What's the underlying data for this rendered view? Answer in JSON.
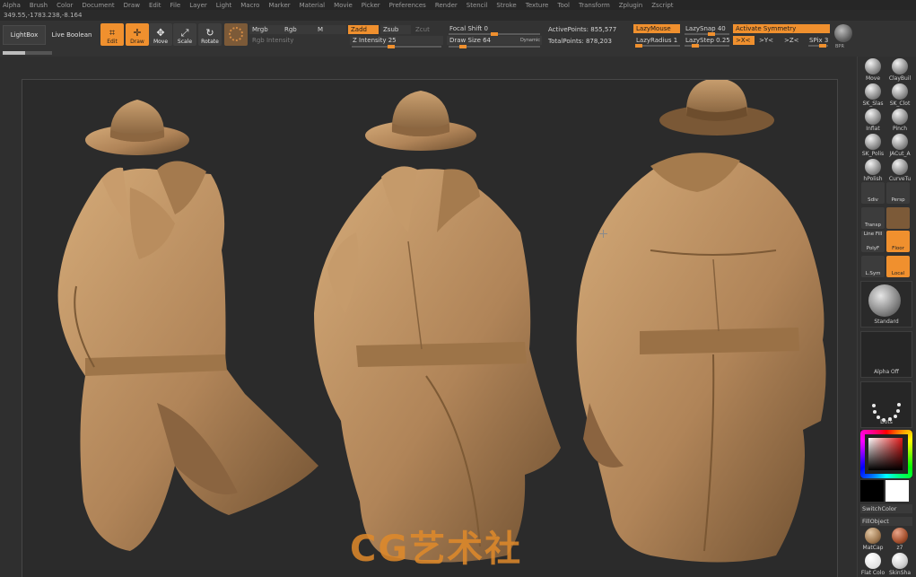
{
  "menu": [
    "Alpha",
    "Brush",
    "Color",
    "Document",
    "Draw",
    "Edit",
    "File",
    "Layer",
    "Light",
    "Macro",
    "Marker",
    "Material",
    "Movie",
    "Picker",
    "Preferences",
    "Render",
    "Stencil",
    "Stroke",
    "Texture",
    "Tool",
    "Transform",
    "Zplugin",
    "Zscript"
  ],
  "coord_readout": "349.55,-1783.238,-8.164",
  "toolbar": {
    "lightbox": "LightBox",
    "live_boolean": "Live Boolean",
    "edit": "Edit",
    "draw": "Draw",
    "move": "Move",
    "scale": "Scale",
    "rotate": "Rotate",
    "mrgb": "Mrgb",
    "rgb": "Rgb",
    "m": "M",
    "rgb_intensity": "Rgb Intensity",
    "zadd": "Zadd",
    "zsub": "Zsub",
    "zcut": "Zcut",
    "z_intensity": "Z Intensity 25",
    "focal_shift": "Focal Shift 0",
    "draw_size": "Draw Size 64",
    "dynamic": "Dynamic",
    "active_points": "ActivePoints: 855,577",
    "total_points": "TotalPoints: 878,203",
    "lazy_mouse": "LazyMouse",
    "lazy_snap": "LazySnap 40",
    "lazy_radius": "LazyRadius 1",
    "lazy_step": "LazyStep 0.25",
    "activate_symmetry": "Activate Symmetry",
    "sym_x": ">X<",
    "sym_y": ">Y<",
    "sym_z": ">Z<",
    "spix": "SPix 3",
    "brush_icon_label": "BPR",
    "progress": 0.45
  },
  "watermark": "CG艺术社",
  "tray": {
    "brushes": [
      "Move",
      "ClayBuil",
      "SK_Slas",
      "SK_Clot",
      "Inflat",
      "Pinch",
      "SK_Polis",
      "JACut_A",
      "hPolish",
      "CurveTu"
    ],
    "sdiv": "Sdiv",
    "persp": "Persp",
    "transp": "Transp",
    "line_fill": "Line Fill",
    "polyf": "PolyF",
    "floor": "Floor",
    "lsym": "L.Sym",
    "local": "Local",
    "current_brush": "Standard",
    "alpha": "Alpha Off",
    "stroke": "Dots",
    "switch_color": "SwitchColor",
    "fill_object": "FillObject",
    "materials": [
      "MatCap",
      "z7",
      "Flat Colo",
      "SkinSha"
    ]
  },
  "colors": {
    "accent": "#f0902e",
    "clay": "#b08458",
    "canvas": "#2b2b2b"
  }
}
